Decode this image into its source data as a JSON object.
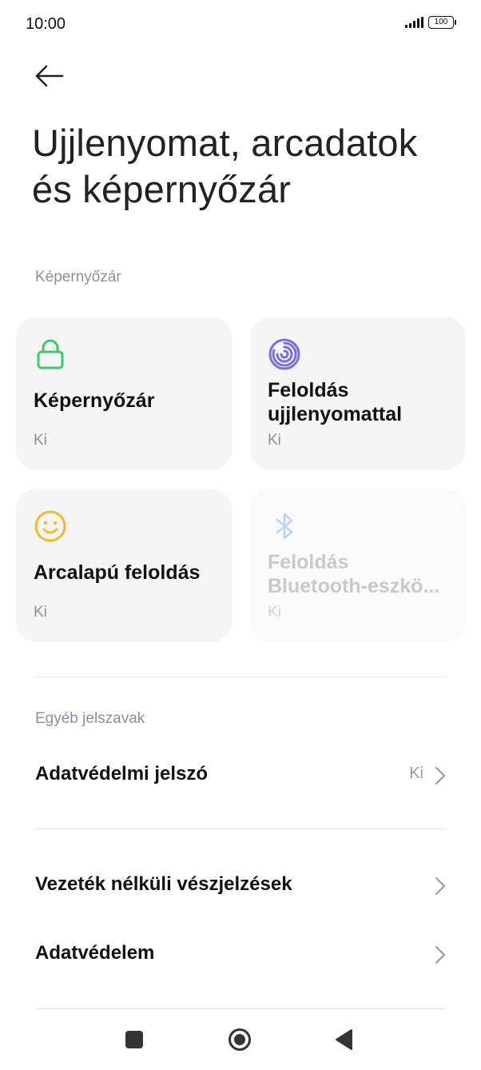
{
  "status_bar": {
    "time": "10:00",
    "battery": "100",
    "signal_icon": "signal-icon",
    "battery_icon": "battery-icon"
  },
  "header": {
    "back_icon": "arrow-left-icon",
    "title": "Ujjlenyomat, arcadatok és képernyőzár"
  },
  "section_screen_lock": {
    "label": "Képernyőzár",
    "cards": [
      {
        "title": "Képernyőzár",
        "status": "Ki",
        "icon": "lock-icon",
        "icon_color": "#3cc96a",
        "enabled": true
      },
      {
        "title_line1": "Feloldás",
        "title_line2": "ujjlenyomattal",
        "status": "Ki",
        "icon": "fingerprint-icon",
        "icon_color": "#7b6fe0",
        "enabled": true
      },
      {
        "title": "Arcalapú feloldás",
        "status": "Ki",
        "icon": "smiley-face-icon",
        "icon_color": "#f5b82e",
        "enabled": true
      },
      {
        "title_line1": "Feloldás",
        "title_line2": "Bluetooth-eszkö...",
        "status": "Ki",
        "icon": "bluetooth-icon",
        "icon_color": "#b9d5f7",
        "enabled": false
      }
    ]
  },
  "section_other_passwords": {
    "label": "Egyéb jelszavak",
    "items": [
      {
        "label": "Adatvédelmi jelszó",
        "value": "Ki"
      }
    ]
  },
  "more_items": [
    {
      "label": "Vezeték nélküli vészjelzések"
    },
    {
      "label": "Adatvédelem"
    }
  ],
  "nav_bar": {
    "recents_icon": "square-recents-icon",
    "home_icon": "circle-home-icon",
    "back_icon": "triangle-back-icon"
  }
}
